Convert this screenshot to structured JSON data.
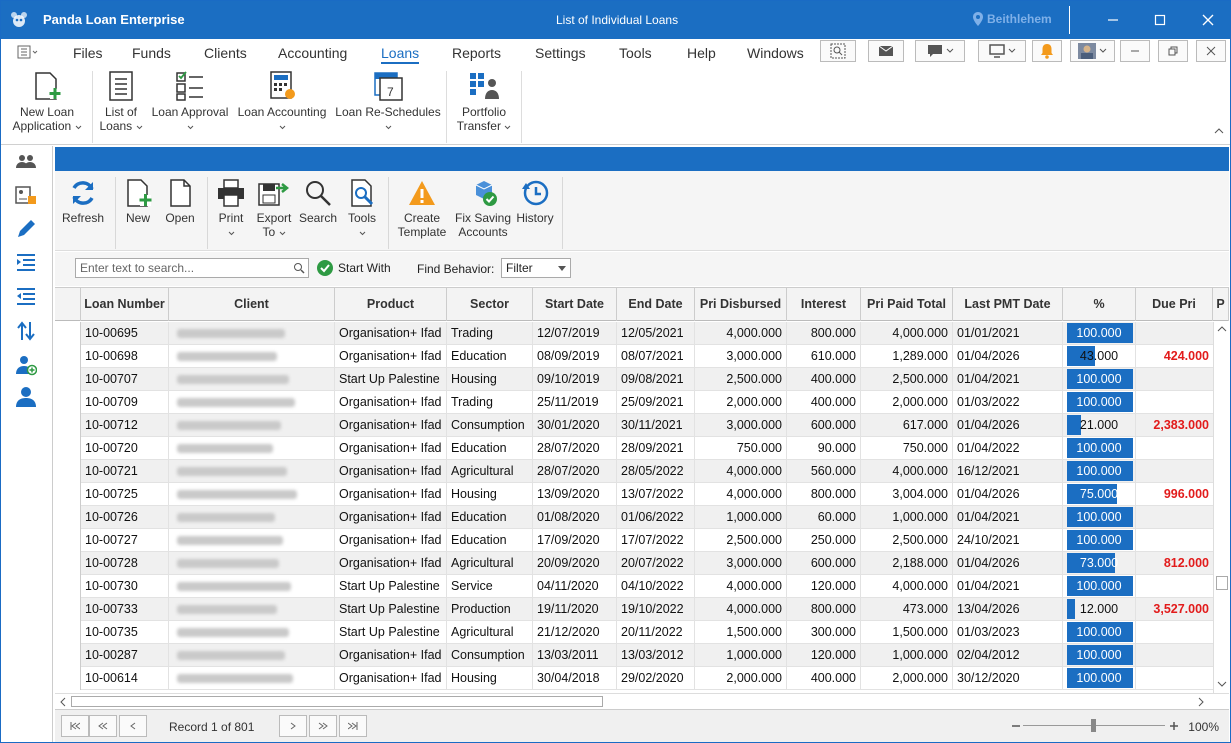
{
  "app": {
    "title": "Panda Loan Enterprise",
    "document": "List of Individual Loans",
    "location": "Beithlehem"
  },
  "menu": [
    "Files",
    "Funds",
    "Clients",
    "Accounting",
    "Loans",
    "Reports",
    "Settings",
    "Tools",
    "Help",
    "Windows"
  ],
  "menu_active": "Loans",
  "ribbon": [
    {
      "label1": "New Loan",
      "label2": "Application",
      "icon": "new-loan-icon"
    },
    {
      "label1": "List of",
      "label2": "Loans",
      "icon": "list-icon"
    },
    {
      "label1": "Loan Approval",
      "label2": "",
      "icon": "approval-icon"
    },
    {
      "label1": "Loan Accounting",
      "label2": "",
      "icon": "calculator-icon"
    },
    {
      "label1": "Loan Re-Schedules",
      "label2": "",
      "icon": "calendar-icon"
    },
    {
      "label1": "Portfolio",
      "label2": "Transfer",
      "icon": "transfer-icon"
    }
  ],
  "toolbar": {
    "refresh": "Refresh",
    "new": "New",
    "open": "Open",
    "print": "Print",
    "export1": "Export",
    "export2": "To",
    "search": "Search",
    "tools": "Tools",
    "create1": "Create",
    "create2": "Template",
    "fix1": "Fix Saving",
    "fix2": "Accounts",
    "history": "History"
  },
  "search": {
    "placeholder": "Enter text to search...",
    "start_with": "Start With",
    "find_behavior": "Find Behavior:",
    "filter": "Filter"
  },
  "columns": [
    "Loan Number",
    "Client",
    "Product",
    "Sector",
    "Start Date",
    "End Date",
    "Pri Disbursed",
    "Interest",
    "Pri Paid Total",
    "Last PMT Date",
    "%",
    "Due Pri",
    "P"
  ],
  "rows": [
    {
      "num": "10-00695",
      "product": "Organisation+ Ifad",
      "sector": "Trading",
      "start": "12/07/2019",
      "end": "12/05/2021",
      "disb": "4,000.000",
      "int": "800.000",
      "paid": "4,000.000",
      "last": "01/01/2021",
      "pct": 100,
      "pct_txt": "100.000",
      "due": ""
    },
    {
      "num": "10-00698",
      "product": "Organisation+ Ifad",
      "sector": "Education",
      "start": "08/09/2019",
      "end": "08/07/2021",
      "disb": "3,000.000",
      "int": "610.000",
      "paid": "1,289.000",
      "last": "01/04/2026",
      "pct": 43,
      "pct_txt": "43.000",
      "due": "424.000"
    },
    {
      "num": "10-00707",
      "product": "Start Up Palestine",
      "sector": "Housing",
      "start": "09/10/2019",
      "end": "09/08/2021",
      "disb": "2,500.000",
      "int": "400.000",
      "paid": "2,500.000",
      "last": "01/04/2021",
      "pct": 100,
      "pct_txt": "100.000",
      "due": ""
    },
    {
      "num": "10-00709",
      "product": "Organisation+ Ifad",
      "sector": "Trading",
      "start": "25/11/2019",
      "end": "25/09/2021",
      "disb": "2,000.000",
      "int": "400.000",
      "paid": "2,000.000",
      "last": "01/03/2022",
      "pct": 100,
      "pct_txt": "100.000",
      "due": ""
    },
    {
      "num": "10-00712",
      "product": "Organisation+ Ifad",
      "sector": "Consumption",
      "start": "30/01/2020",
      "end": "30/11/2021",
      "disb": "3,000.000",
      "int": "600.000",
      "paid": "617.000",
      "last": "01/04/2026",
      "pct": 21,
      "pct_txt": "21.000",
      "due": "2,383.000"
    },
    {
      "num": "10-00720",
      "product": "Organisation+ Ifad",
      "sector": "Education",
      "start": "28/07/2020",
      "end": "28/09/2021",
      "disb": "750.000",
      "int": "90.000",
      "paid": "750.000",
      "last": "01/04/2022",
      "pct": 100,
      "pct_txt": "100.000",
      "due": ""
    },
    {
      "num": "10-00721",
      "product": "Organisation+ Ifad",
      "sector": "Agricultural",
      "start": "28/07/2020",
      "end": "28/05/2022",
      "disb": "4,000.000",
      "int": "560.000",
      "paid": "4,000.000",
      "last": "16/12/2021",
      "pct": 100,
      "pct_txt": "100.000",
      "due": ""
    },
    {
      "num": "10-00725",
      "product": "Organisation+ Ifad",
      "sector": "Housing",
      "start": "13/09/2020",
      "end": "13/07/2022",
      "disb": "4,000.000",
      "int": "800.000",
      "paid": "3,004.000",
      "last": "01/04/2026",
      "pct": 75,
      "pct_txt": "75.000",
      "due": "996.000"
    },
    {
      "num": "10-00726",
      "product": "Organisation+ Ifad",
      "sector": "Education",
      "start": "01/08/2020",
      "end": "01/06/2022",
      "disb": "1,000.000",
      "int": "60.000",
      "paid": "1,000.000",
      "last": "01/04/2021",
      "pct": 100,
      "pct_txt": "100.000",
      "due": ""
    },
    {
      "num": "10-00727",
      "product": "Organisation+ Ifad",
      "sector": "Education",
      "start": "17/09/2020",
      "end": "17/07/2022",
      "disb": "2,500.000",
      "int": "250.000",
      "paid": "2,500.000",
      "last": "24/10/2021",
      "pct": 100,
      "pct_txt": "100.000",
      "due": ""
    },
    {
      "num": "10-00728",
      "product": "Organisation+ Ifad",
      "sector": "Agricultural",
      "start": "20/09/2020",
      "end": "20/07/2022",
      "disb": "3,000.000",
      "int": "600.000",
      "paid": "2,188.000",
      "last": "01/04/2026",
      "pct": 73,
      "pct_txt": "73.000",
      "due": "812.000"
    },
    {
      "num": "10-00730",
      "product": "Start Up Palestine",
      "sector": "Service",
      "start": "04/11/2020",
      "end": "04/10/2022",
      "disb": "4,000.000",
      "int": "120.000",
      "paid": "4,000.000",
      "last": "01/04/2021",
      "pct": 100,
      "pct_txt": "100.000",
      "due": ""
    },
    {
      "num": "10-00733",
      "product": "Start Up Palestine",
      "sector": "Production",
      "start": "19/11/2020",
      "end": "19/10/2022",
      "disb": "4,000.000",
      "int": "800.000",
      "paid": "473.000",
      "last": "13/04/2026",
      "pct": 12,
      "pct_txt": "12.000",
      "due": "3,527.000"
    },
    {
      "num": "10-00735",
      "product": "Start Up Palestine",
      "sector": "Agricultural",
      "start": "21/12/2020",
      "end": "20/11/2022",
      "disb": "1,500.000",
      "int": "300.000",
      "paid": "1,500.000",
      "last": "01/03/2023",
      "pct": 100,
      "pct_txt": "100.000",
      "due": ""
    },
    {
      "num": "10-00287",
      "product": "Organisation+ Ifad",
      "sector": "Consumption",
      "start": "13/03/2011",
      "end": "13/03/2012",
      "disb": "1,000.000",
      "int": "120.000",
      "paid": "1,000.000",
      "last": "02/04/2012",
      "pct": 100,
      "pct_txt": "100.000",
      "due": ""
    },
    {
      "num": "10-00614",
      "product": "Organisation+ Ifad",
      "sector": "Housing",
      "start": "30/04/2018",
      "end": "29/02/2020",
      "disb": "2,000.000",
      "int": "400.000",
      "paid": "2,000.000",
      "last": "30/12/2020",
      "pct": 100,
      "pct_txt": "100.000",
      "due": ""
    }
  ],
  "footer": {
    "record": "Record 1 of 801",
    "zoom": "100%"
  },
  "colors": {
    "accent": "#1b6ec2",
    "due": "#e21b1b"
  }
}
